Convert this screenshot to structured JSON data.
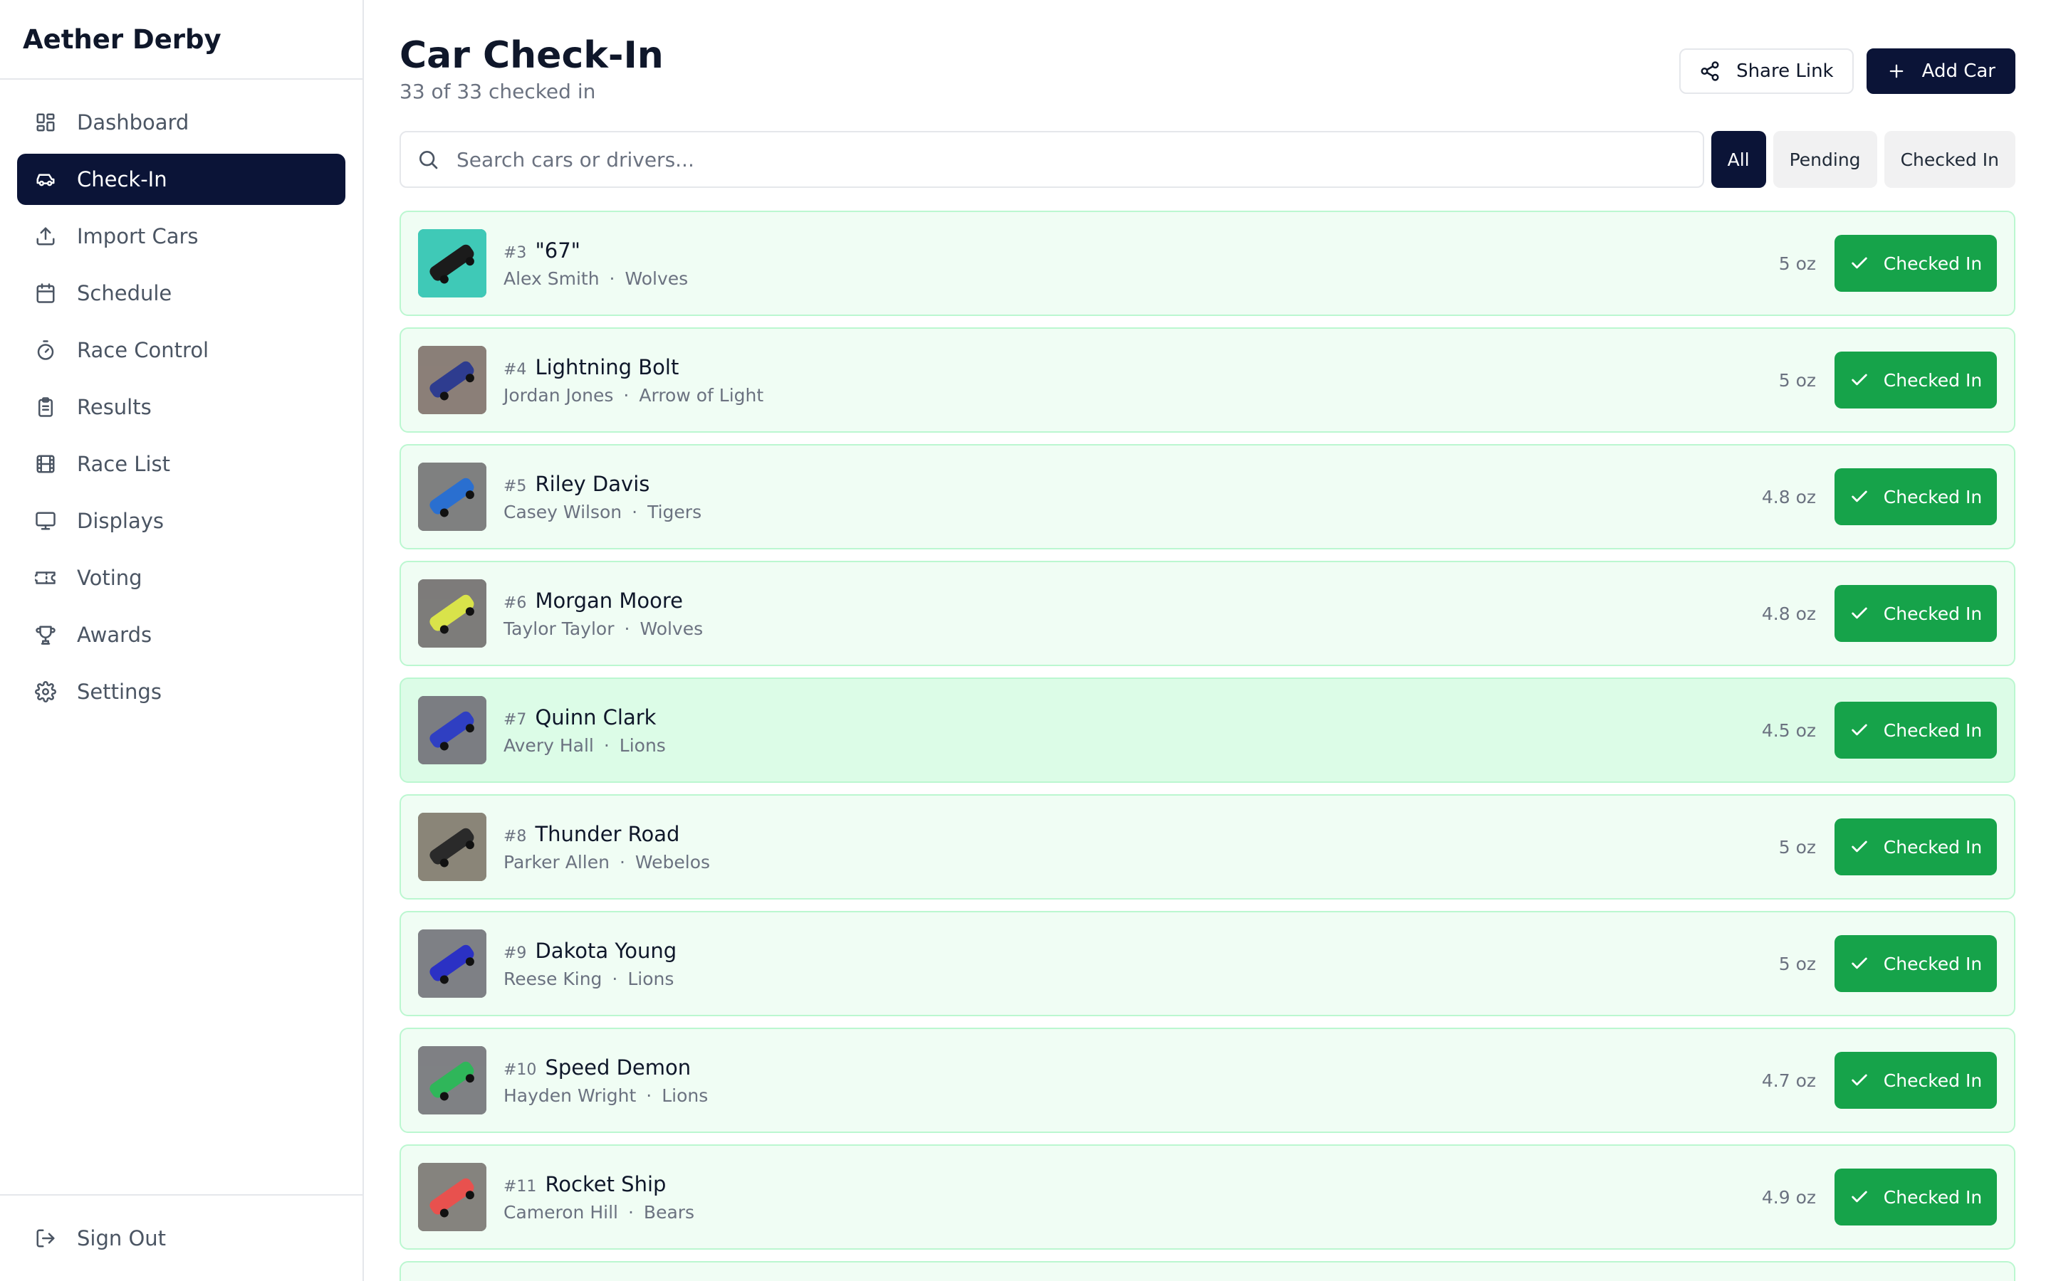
{
  "app": {
    "name": "Aether Derby"
  },
  "sidebar": {
    "items": [
      {
        "label": "Dashboard",
        "icon": "dashboard-icon",
        "active": false
      },
      {
        "label": "Check-In",
        "icon": "car-icon",
        "active": true
      },
      {
        "label": "Import Cars",
        "icon": "upload-icon",
        "active": false
      },
      {
        "label": "Schedule",
        "icon": "calendar-icon",
        "active": false
      },
      {
        "label": "Race Control",
        "icon": "stopwatch-icon",
        "active": false
      },
      {
        "label": "Results",
        "icon": "clipboard-icon",
        "active": false
      },
      {
        "label": "Race List",
        "icon": "film-icon",
        "active": false
      },
      {
        "label": "Displays",
        "icon": "monitor-icon",
        "active": false
      },
      {
        "label": "Voting",
        "icon": "ticket-icon",
        "active": false
      },
      {
        "label": "Awards",
        "icon": "trophy-icon",
        "active": false
      },
      {
        "label": "Settings",
        "icon": "gear-icon",
        "active": false
      }
    ],
    "sign_out": "Sign Out"
  },
  "header": {
    "title": "Car Check-In",
    "subtitle": "33 of 33 checked in",
    "share_label": "Share Link",
    "add_label": "Add Car"
  },
  "search": {
    "placeholder": "Search cars or drivers..."
  },
  "filters": [
    {
      "label": "All",
      "active": true
    },
    {
      "label": "Pending",
      "active": false
    },
    {
      "label": "Checked In",
      "active": false
    }
  ],
  "cars": [
    {
      "number": "#3",
      "name": "\"67\"",
      "driver": "Alex Smith",
      "den": "Wolves",
      "weight": "5 oz",
      "status": "Checked In",
      "photo_colors": [
        "#3fc9b7",
        "#1b1b1b"
      ]
    },
    {
      "number": "#4",
      "name": "Lightning Bolt",
      "driver": "Jordan Jones",
      "den": "Arrow of Light",
      "weight": "5 oz",
      "status": "Checked In",
      "photo_colors": [
        "#8b7f78",
        "#2e3c8f"
      ]
    },
    {
      "number": "#5",
      "name": "Riley Davis",
      "driver": "Casey Wilson",
      "den": "Tigers",
      "weight": "4.8 oz",
      "status": "Checked In",
      "photo_colors": [
        "#7f8080",
        "#2a6fd0"
      ]
    },
    {
      "number": "#6",
      "name": "Morgan Moore",
      "driver": "Taylor Taylor",
      "den": "Wolves",
      "weight": "4.8 oz",
      "status": "Checked In",
      "photo_colors": [
        "#7d7c7a",
        "#d9e34a"
      ]
    },
    {
      "number": "#7",
      "name": "Quinn Clark",
      "driver": "Avery Hall",
      "den": "Lions",
      "weight": "4.5 oz",
      "status": "Checked In",
      "photo_colors": [
        "#7b7d82",
        "#2f3fc2"
      ]
    },
    {
      "number": "#8",
      "name": "Thunder Road",
      "driver": "Parker Allen",
      "den": "Webelos",
      "weight": "5 oz",
      "status": "Checked In",
      "photo_colors": [
        "#8a8578",
        "#2a2a2a"
      ]
    },
    {
      "number": "#9",
      "name": "Dakota Young",
      "driver": "Reese King",
      "den": "Lions",
      "weight": "5 oz",
      "status": "Checked In",
      "photo_colors": [
        "#7e8085",
        "#2b31c4"
      ]
    },
    {
      "number": "#10",
      "name": "Speed Demon",
      "driver": "Hayden Wright",
      "den": "Lions",
      "weight": "4.7 oz",
      "status": "Checked In",
      "photo_colors": [
        "#7f8184",
        "#2fb65a"
      ]
    },
    {
      "number": "#11",
      "name": "Rocket Ship",
      "driver": "Cameron Hill",
      "den": "Bears",
      "weight": "4.9 oz",
      "status": "Checked In",
      "photo_colors": [
        "#85837e",
        "#e8514e"
      ]
    }
  ],
  "colors": {
    "primary_dark": "#0b1437",
    "success": "#16a34a",
    "row_bg": "#f0fdf4",
    "row_border": "#bbf7d0"
  }
}
